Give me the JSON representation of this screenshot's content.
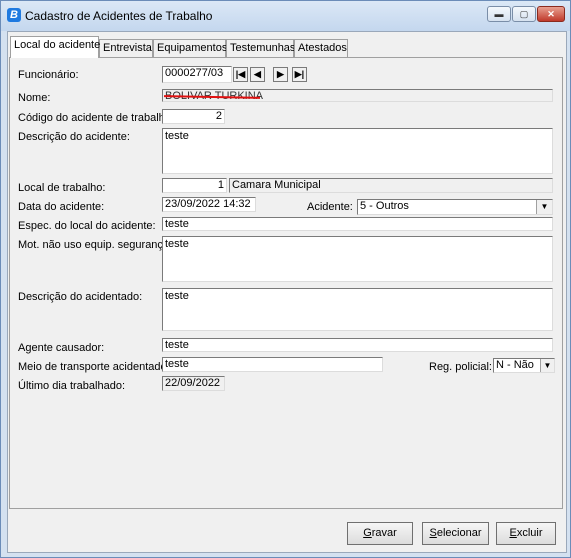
{
  "window": {
    "title": "Cadastro de Acidentes de Trabalho",
    "app_icon_letter": "B",
    "min_glyph": "▬",
    "max_glyph": "▢",
    "close_glyph": "✕"
  },
  "tabs": [
    {
      "label": "Local do acidente",
      "active": true
    },
    {
      "label": "Entrevista"
    },
    {
      "label": "Equipamentos"
    },
    {
      "label": "Testemunhas"
    },
    {
      "label": "Atestados"
    }
  ],
  "form": {
    "funcionario": {
      "label": "Funcionário:",
      "value": "0000277/03"
    },
    "nav": {
      "first": "|◀",
      "prev": "◀",
      "next": "▶",
      "last": "▶|"
    },
    "nome": {
      "label": "Nome:",
      "value": "BOLIVAR TURKINA"
    },
    "codigo": {
      "label": "Código do acidente de trabalho:",
      "value": "2"
    },
    "descricao": {
      "label": "Descrição do acidente:",
      "value": "teste"
    },
    "local_trabalho": {
      "label": "Local de trabalho:",
      "code": "1",
      "name": "Camara Municipal"
    },
    "data": {
      "label": "Data do acidente:",
      "value": "23/09/2022 14:32"
    },
    "acidente": {
      "label": "Acidente:",
      "value": "5 - Outros"
    },
    "espec_local": {
      "label": "Espec. do local do acidente:",
      "value": "teste"
    },
    "mot_nao_uso": {
      "label": "Mot. não uso equip. segurança:",
      "value": "teste"
    },
    "desc_acidentado": {
      "label": "Descrição do acidentado:",
      "value": "teste"
    },
    "agente": {
      "label": "Agente causador:",
      "value": "teste"
    },
    "meio_transporte": {
      "label": "Meio de transporte acidentado:",
      "value": "teste"
    },
    "reg_policial": {
      "label": "Reg. policial:",
      "value": "N - Não"
    },
    "ultimo_dia": {
      "label": "Último dia trabalhado:",
      "value": "22/09/2022"
    }
  },
  "buttons": {
    "gravar": {
      "mnemonic": "G",
      "rest": "ravar"
    },
    "selecionar": {
      "mnemonic": "S",
      "rest": "elecionar"
    },
    "excluir": {
      "mnemonic": "E",
      "rest": "xcluir"
    }
  },
  "colors": {
    "title_bar": "#c4d7ee",
    "close_button": "#c0392b",
    "redaction": "#e01010"
  }
}
